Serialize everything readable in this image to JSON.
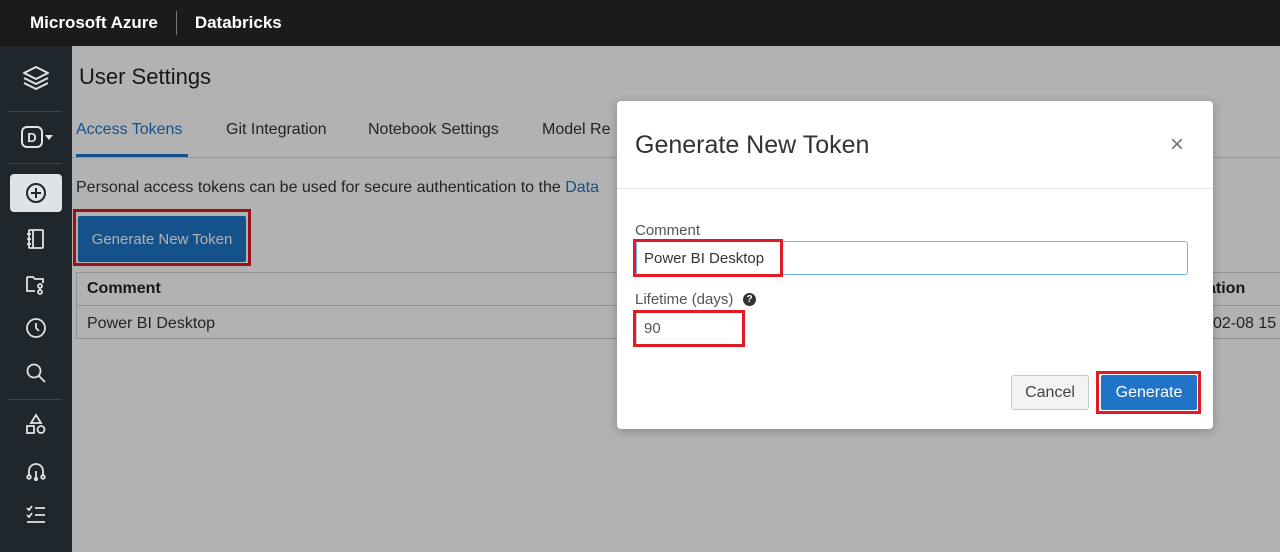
{
  "topbar": {
    "brand": "Microsoft Azure",
    "product": "Databricks"
  },
  "sidenav": {
    "items": [
      {
        "icon": "stack-icon"
      },
      {
        "icon": "workspace-switcher-icon",
        "letter": "D"
      },
      {
        "icon": "create-plus-icon",
        "active": true
      },
      {
        "icon": "notebook-icon"
      },
      {
        "icon": "repos-icon"
      },
      {
        "icon": "recents-clock-icon"
      },
      {
        "icon": "search-icon"
      },
      {
        "icon": "shapes-icon"
      },
      {
        "icon": "hierarchy-icon"
      },
      {
        "icon": "checklist-icon"
      }
    ]
  },
  "page": {
    "title": "User Settings",
    "tabs": [
      {
        "label": "Access Tokens",
        "active": true
      },
      {
        "label": "Git Integration"
      },
      {
        "label": "Notebook Settings"
      },
      {
        "label": "Model Re"
      }
    ],
    "description": "Personal access tokens can be used for secure authentication to the ",
    "description_link": "Data",
    "generate_button": "Generate New Token",
    "table": {
      "headers": [
        "Comment",
        "ation"
      ],
      "rows": [
        {
          "comment": "Power BI Desktop",
          "expiration": "02-08 15"
        }
      ]
    }
  },
  "modal": {
    "title": "Generate New Token",
    "close": "×",
    "comment_label": "Comment",
    "comment_value": "Power BI Desktop",
    "lifetime_label": "Lifetime (days)",
    "lifetime_help": "?",
    "lifetime_value": "90",
    "cancel_label": "Cancel",
    "generate_label": "Generate"
  },
  "colors": {
    "accent": "#1f74c7",
    "highlight": "#e01b24",
    "topbar": "#1b1b1b",
    "sidebar": "#1f272d"
  }
}
